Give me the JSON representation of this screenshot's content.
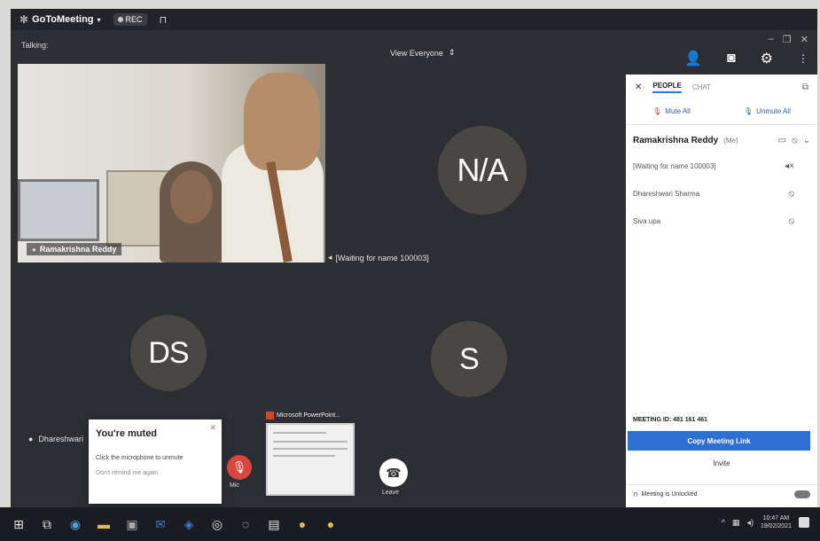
{
  "window": {
    "brand": "GoToMeeting",
    "rec_label": "REC"
  },
  "topbar": {
    "talking": "Talking:",
    "view_select": "View Everyone"
  },
  "tiles": {
    "video_name": "Ramakrishna Reddy",
    "waiting_label": "[Waiting for name 100003]",
    "initials_na": "N/A",
    "initials_ds": "DS",
    "initials_s": "S",
    "presenter_label": "Dhareshwari"
  },
  "muted_popup": {
    "title": "You're muted",
    "desc": "Click the microphone to unmute",
    "dont_show": "Don't remind me again"
  },
  "controls": {
    "mic_label": "Mic",
    "screen_title": "Microsoft PowerPoint...",
    "leave_label": "Leave"
  },
  "panel": {
    "tab_people": "PEOPLE",
    "tab_chat": "CHAT",
    "mute_all": "Mute All",
    "unmute_all": "Unmute All",
    "host_name": "Ramakrishna Reddy",
    "host_tag": "(Me)",
    "participants": [
      {
        "name": "[Waiting for name 100003]",
        "icon": "speaker-muted-icon"
      },
      {
        "name": "Dhareshwari Sharma",
        "icon": "mic-muted-icon"
      },
      {
        "name": "Siva upa",
        "icon": "mic-muted-icon"
      }
    ],
    "meeting_id": "MEETING ID: 481 161 461",
    "copy_link": "Copy Meeting Link",
    "invite": "Invite",
    "footer": "Meeting is Unlocked"
  },
  "taskbar": {
    "time": "10:47 AM",
    "date": "19/02/2021"
  },
  "colors": {
    "app_bg": "#2d2e33",
    "accent_blue": "#2d6fd2",
    "mic_red": "#d9453f",
    "avatar_bg": "#4a4643"
  }
}
